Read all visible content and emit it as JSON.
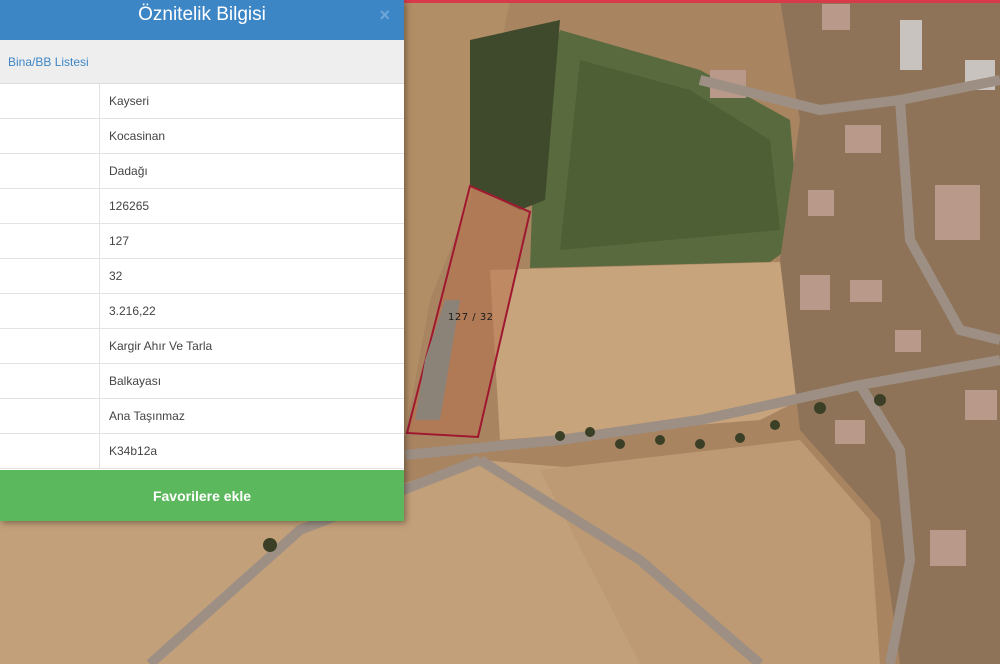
{
  "panel": {
    "title": "Öznitelik Bilgisi",
    "close_symbol": "×",
    "list_link": "Bina/BB Listesi",
    "rows": [
      "Kayseri",
      "Kocasinan",
      "Dadağı",
      "126265",
      "127",
      "32",
      "3.216,22",
      "Kargir Ahır Ve Tarla",
      "Balkayası",
      "Ana Taşınmaz",
      "K34b12a"
    ],
    "favorite_button": "Favorilere ekle"
  },
  "map": {
    "parcel_label": "127 / 32",
    "parcel_outline_color": "#a01830"
  },
  "colors": {
    "header": "#3d86c6",
    "button": "#5cb85c",
    "top_line": "#d83a4a"
  }
}
